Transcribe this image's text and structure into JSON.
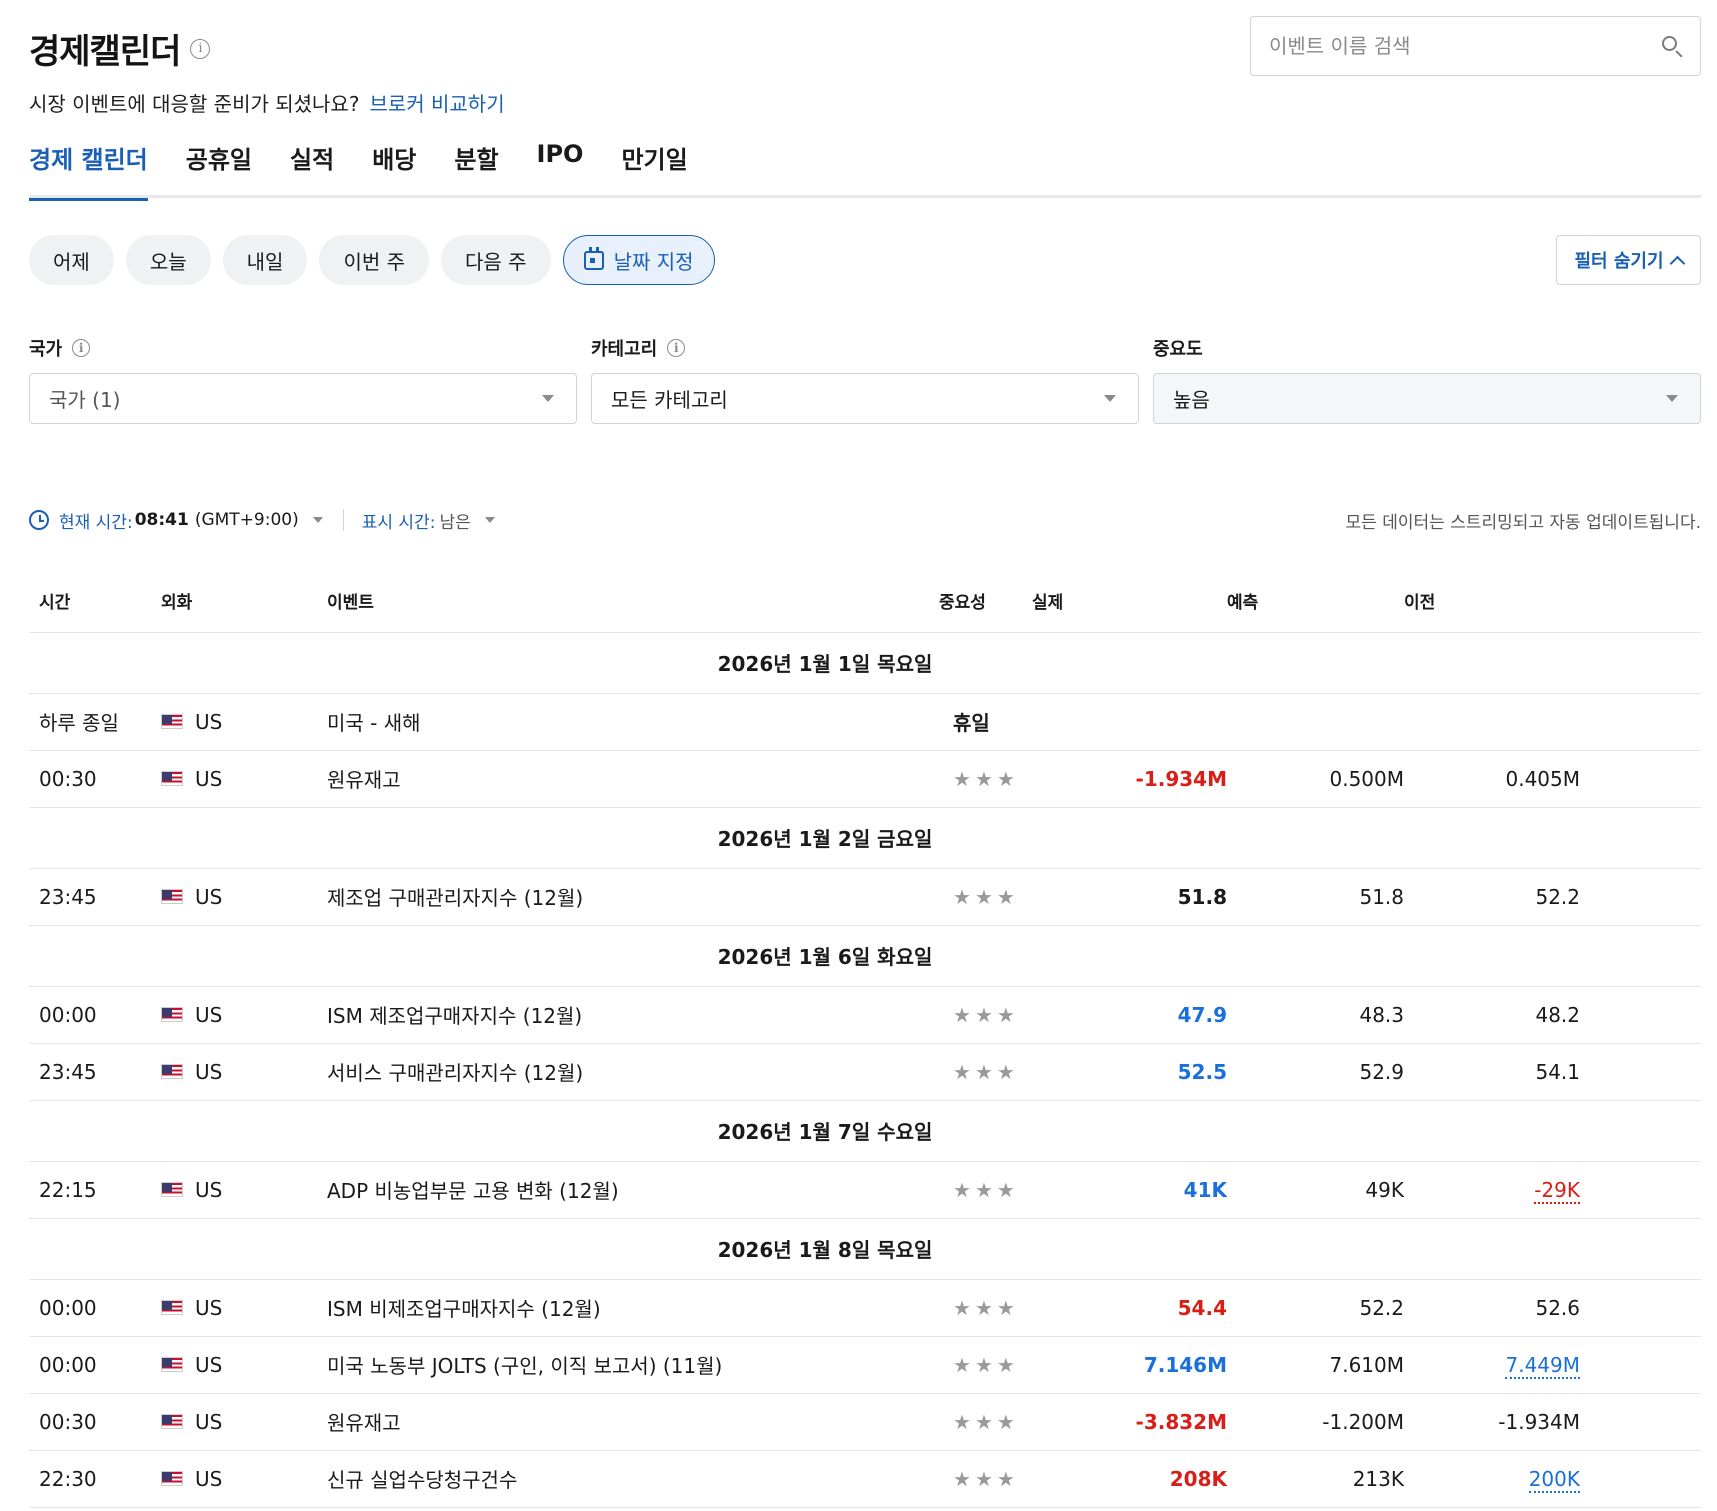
{
  "header": {
    "title": "경제캘린더",
    "info_glyph": "i",
    "subtitle": "시장 이벤트에 대응할 준비가 되셨나요?",
    "subtitle_link": "브로커 비교하기"
  },
  "search": {
    "placeholder": "이벤트 이름 검색",
    "value": ""
  },
  "tabs": [
    {
      "label": "경제 캘린더",
      "active": true
    },
    {
      "label": "공휴일"
    },
    {
      "label": "실적"
    },
    {
      "label": "배당"
    },
    {
      "label": "분할"
    },
    {
      "label": "IPO"
    },
    {
      "label": "만기일"
    }
  ],
  "date_pills": [
    "어제",
    "오늘",
    "내일",
    "이번 주",
    "다음 주"
  ],
  "custom_date_label": "날짜 지정",
  "filter_toggle_label": "필터 숨기기",
  "filters": {
    "country": {
      "label": "국가",
      "value": "국가 (1)"
    },
    "category": {
      "label": "카테고리",
      "value": "모든 카테고리"
    },
    "importance": {
      "label": "중요도",
      "value": "높음"
    }
  },
  "timebar": {
    "current_label": "현재 시간:",
    "current_time": "08:41",
    "offset": "(GMT+9:00)",
    "display_label": "표시 시간:",
    "display_value": "남은",
    "stream_note": "모든 데이터는 스트리밍되고 자동 업데이트됩니다."
  },
  "columns": {
    "time": "시간",
    "currency": "외화",
    "event": "이벤트",
    "importance": "중요성",
    "actual": "실제",
    "forecast": "예측",
    "previous": "이전"
  },
  "star_glyph": "★",
  "days": [
    {
      "date": "2026년 1월 1일 목요일",
      "events": [
        {
          "time": "하루 종일",
          "currency": "US",
          "event": "미국 - 새해",
          "holiday": "휴일"
        },
        {
          "time": "00:30",
          "currency": "US",
          "event": "원유재고",
          "actual": "-1.934M",
          "actual_color": "red",
          "forecast": "0.500M",
          "previous": "0.405M"
        }
      ]
    },
    {
      "date": "2026년 1월 2일 금요일",
      "events": [
        {
          "time": "23:45",
          "currency": "US",
          "event": "제조업 구매관리자지수  (12월)",
          "actual": "51.8",
          "actual_color": "black",
          "forecast": "51.8",
          "previous": "52.2"
        }
      ]
    },
    {
      "date": "2026년 1월 6일 화요일",
      "events": [
        {
          "time": "00:00",
          "currency": "US",
          "event": "ISM 제조업구매자지수  (12월)",
          "actual": "47.9",
          "actual_color": "blue",
          "forecast": "48.3",
          "previous": "48.2"
        },
        {
          "time": "23:45",
          "currency": "US",
          "event": "서비스 구매관리자지수  (12월)",
          "actual": "52.5",
          "actual_color": "blue",
          "forecast": "52.9",
          "previous": "54.1"
        }
      ]
    },
    {
      "date": "2026년 1월 7일 수요일",
      "events": [
        {
          "time": "22:15",
          "currency": "US",
          "event": "ADP 비농업부문 고용 변화  (12월)",
          "actual": "41K",
          "actual_color": "blue",
          "forecast": "49K",
          "previous": "-29K",
          "previous_style": "dotted-red"
        }
      ]
    },
    {
      "date": "2026년 1월 8일 목요일",
      "events": [
        {
          "time": "00:00",
          "currency": "US",
          "event": "ISM 비제조업구매자지수  (12월)",
          "actual": "54.4",
          "actual_color": "red",
          "forecast": "52.2",
          "previous": "52.6"
        },
        {
          "time": "00:00",
          "currency": "US",
          "event": "미국 노동부 JOLTS (구인, 이직 보고서)  (11월)",
          "actual": "7.146M",
          "actual_color": "blue",
          "forecast": "7.610M",
          "previous": "7.449M",
          "previous_style": "dotted-blue"
        },
        {
          "time": "00:30",
          "currency": "US",
          "event": "원유재고",
          "actual": "-3.832M",
          "actual_color": "red",
          "forecast": "-1.200M",
          "previous": "-1.934M"
        },
        {
          "time": "22:30",
          "currency": "US",
          "event": "신규 실업수당청구건수",
          "actual": "208K",
          "actual_color": "red",
          "forecast": "213K",
          "previous": "200K",
          "previous_style": "dotted-blue"
        }
      ]
    }
  ],
  "colors": {
    "accent": "#1a5fb4",
    "negative": "#d91e18",
    "positive": "#1a6fdb"
  }
}
